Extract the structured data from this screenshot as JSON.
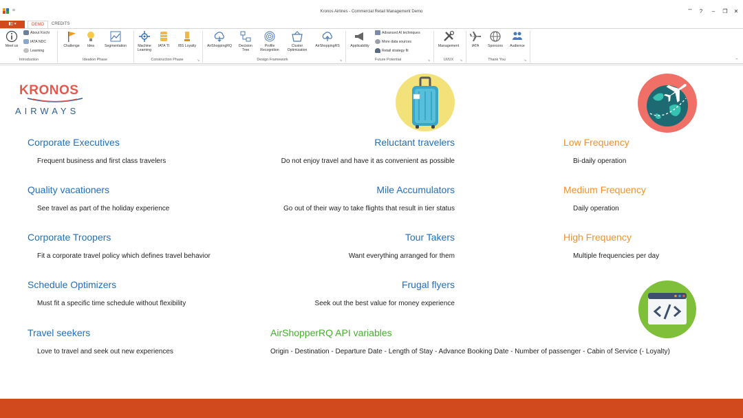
{
  "window": {
    "title": "Kronos Airlines - Commercial Retail Management Demo",
    "controls": {
      "help": "?",
      "minimize": "–",
      "restore": "❐",
      "close": "✕"
    }
  },
  "tabs": {
    "file": "▮▯ ▾",
    "items": [
      "DEMO",
      "CREDITS"
    ],
    "active": "DEMO"
  },
  "ribbon": {
    "groups": {
      "introduction": "Introduction",
      "ideation": "Ideation Phase",
      "construction": "Construction Phase",
      "design": "Design Framework",
      "future": "Future Potential",
      "uiux": "UI/UX",
      "thankyou": "Thank You"
    },
    "buttons": {
      "meet_us": "Meet us",
      "about_kochi": "About Kochi",
      "iata_ndc": "IATA NDC",
      "learning": "Learning",
      "challenge": "Challenge",
      "idea": "Idea",
      "segmentation": "Segmentation",
      "ml_1": "Machine",
      "ml_2": "Learning",
      "iata_ti": "IATA TI",
      "ibs_loyalty": "IBS Loyalty",
      "airshoppingrq": "AirShoppingRQ",
      "dt_1": "Decision",
      "dt_2": "Tree",
      "pr_1": "Profile",
      "pr_2": "Recognition",
      "co_1": "Cluster",
      "co_2": "Optimization",
      "airshoppingrs": "AirShoppingRS",
      "applicability": "Applicability",
      "adv_ai": "Advanced AI techniques",
      "more_data": "More data sources",
      "retail_fit": "Retail strategy fit",
      "management": "Management",
      "iata": "IATA",
      "sponsors": "Sponsors",
      "audience": "Audience"
    }
  },
  "logo": {
    "top": "KRONOS",
    "bottom": "AIRWAYS"
  },
  "segments": {
    "col1": [
      {
        "title": "Corporate Executives",
        "desc": "Frequent business and first class travelers"
      },
      {
        "title": "Quality vacationers",
        "desc": "See travel as part of the holiday experience"
      },
      {
        "title": "Corporate Troopers",
        "desc": "Fit a corporate travel policy which defines travel behavior"
      },
      {
        "title": "Schedule Optimizers",
        "desc": "Must fit a specific time schedule without flexibility"
      },
      {
        "title": "Travel seekers",
        "desc": "Love to travel and seek out new experiences"
      }
    ],
    "col2": [
      {
        "title": "Reluctant travelers",
        "desc": "Do not enjoy travel and have it as convenient as possible"
      },
      {
        "title": "Mile Accumulators",
        "desc": "Go out of their way to take flights that result in tier status"
      },
      {
        "title": "Tour Takers",
        "desc": "Want everything arranged for them"
      },
      {
        "title": "Frugal flyers",
        "desc": "Seek out the best value for money experience"
      }
    ],
    "col3": [
      {
        "title": "Low Frequency",
        "desc": "Bi-daily operation"
      },
      {
        "title": "Medium Frequency",
        "desc": "Daily operation"
      },
      {
        "title": "High Frequency",
        "desc": "Multiple frequencies per day"
      }
    ]
  },
  "api": {
    "title": "AirShopperRQ API variables",
    "desc": "Origin - Destination - Departure Date - Length of Stay - Advance Booking Date - Number of passenger - Cabin of Service (- Loyalty)"
  },
  "icons": {
    "logo": "kronos-airways-logo",
    "suitcase": "suitcase-icon",
    "globe_plane": "globe-plane-icon",
    "code": "code-window-icon"
  },
  "colors": {
    "accent": "#d14a1e",
    "heading_blue": "#1f6fbe",
    "heading_orange": "#f0922b",
    "heading_green": "#43b02a"
  }
}
